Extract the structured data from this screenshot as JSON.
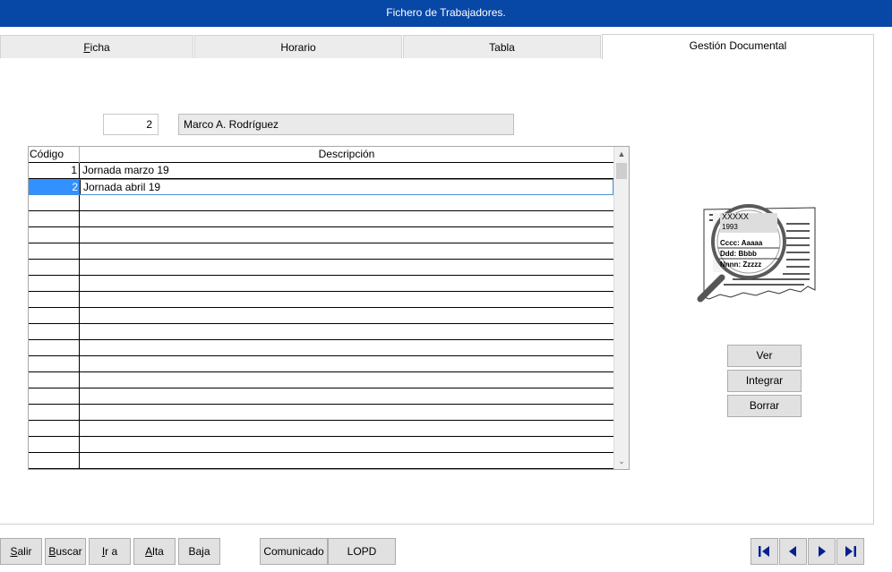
{
  "window": {
    "title": "Fichero de Trabajadores."
  },
  "tabs": [
    {
      "label": "Ficha",
      "active": false
    },
    {
      "label": "Horario",
      "active": false
    },
    {
      "label": "Tabla",
      "active": false
    },
    {
      "label": "Gestión Documental",
      "active": true
    }
  ],
  "record": {
    "number": "2",
    "name": "Marco A. Rodríguez"
  },
  "grid": {
    "headers": {
      "codigo": "Código",
      "descripcion": "Descripción"
    },
    "rows": [
      {
        "codigo": "1",
        "descripcion": "Jornada marzo 19"
      },
      {
        "codigo": "2",
        "descripcion": "Jornada abril 19"
      }
    ],
    "selected_row": 2
  },
  "graphic": {
    "lines": [
      "XXXXX",
      "1993",
      "Cccc: Aaaaa",
      "Ddd: Bbbb",
      "Nnnn: Zzzzz"
    ],
    "icon": "document-magnifier-icon"
  },
  "side_buttons": {
    "ver": "Ver",
    "integrar": "Integrar",
    "borrar": "Borrar"
  },
  "bottom_buttons": {
    "salir": {
      "first": "S",
      "rest": "alir"
    },
    "buscar": {
      "first": "B",
      "rest": "uscar"
    },
    "ir": {
      "first": "I",
      "rest": "r a"
    },
    "alta": {
      "first": "A",
      "rest": "lta"
    },
    "baja": "Baja",
    "comunicado": "Comunicado",
    "lopd": "LOPD"
  },
  "tab_ficha": {
    "first": "F",
    "rest": "icha"
  },
  "nav": {
    "first": "first-record-icon",
    "prev": "previous-record-icon",
    "next": "next-record-icon",
    "last": "last-record-icon",
    "color": "#0a1f8f"
  }
}
